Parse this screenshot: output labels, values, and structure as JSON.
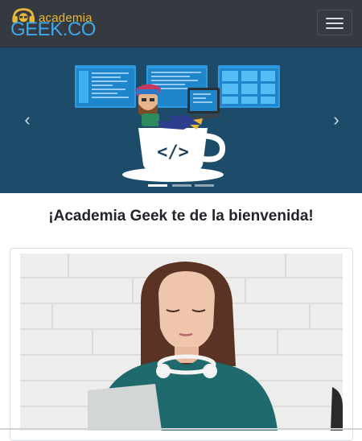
{
  "navbar": {
    "brand_top": "academia",
    "brand_bottom": "GEEK.CO",
    "toggler_label": "Toggle navigation"
  },
  "carousel": {
    "prev_label": "Previous",
    "next_label": "Next",
    "slide_count": 3,
    "active_slide": 0,
    "background_color": "#1d4c6b"
  },
  "main": {
    "welcome_text": "¡Academia Geek te de la bienvenida!"
  },
  "colors": {
    "navbar_bg": "#343a40",
    "brand_gold": "#e9b73a",
    "brand_blue": "#3fa7ec"
  }
}
